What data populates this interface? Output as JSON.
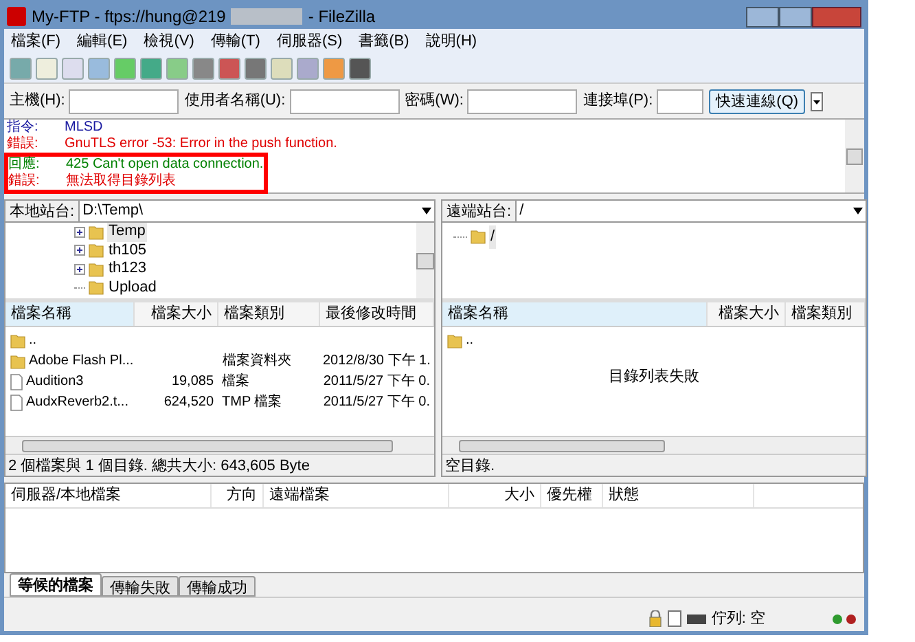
{
  "window": {
    "title_start": "My-FTP - ftps://hung@219",
    "title_end": "- FileZilla"
  },
  "menu": [
    "檔案(F)",
    "編輯(E)",
    "檢視(V)",
    "傳輸(T)",
    "伺服器(S)",
    "書籤(B)",
    "說明(H)"
  ],
  "quickconnect": {
    "fields": [
      {
        "label": "主機(H):"
      },
      {
        "label": "使用者名稱(U):"
      },
      {
        "label": "密碼(W):"
      },
      {
        "label": "連接埠(P):"
      }
    ],
    "button": "快速連線(Q)"
  },
  "log": [
    {
      "kind": "command",
      "prefix": "指令:",
      "text": "MLSD",
      "highlighted": false
    },
    {
      "kind": "error",
      "prefix": "錯誤:",
      "text": "GnuTLS error -53: Error in the push function.",
      "highlighted": false
    },
    {
      "kind": "response",
      "prefix": "回應:",
      "text": "425 Can't open data connection.",
      "highlighted": true
    },
    {
      "kind": "error",
      "prefix": "錯誤:",
      "text": "無法取得目錄列表",
      "highlighted": true
    }
  ],
  "local": {
    "label": "本地站台:",
    "path": "D:\\Temp\\",
    "tree": [
      {
        "name": "Temp",
        "expandable": true,
        "selected": true
      },
      {
        "name": "th105",
        "expandable": true,
        "selected": false
      },
      {
        "name": "th123",
        "expandable": true,
        "selected": false
      },
      {
        "name": "Upload",
        "expandable": false,
        "selected": false
      }
    ],
    "columns": [
      "檔案名稱",
      "檔案大小",
      "檔案類別",
      "最後修改時間"
    ],
    "rows": [
      {
        "kind": "folder",
        "cells": [
          "..",
          "",
          "",
          ""
        ]
      },
      {
        "kind": "folder",
        "cells": [
          "Adobe Flash Pl...",
          "",
          "檔案資料夾",
          "2012/8/30 下午 1."
        ]
      },
      {
        "kind": "file",
        "cells": [
          "Audition3",
          "19,085",
          "檔案",
          "2011/5/27 下午 0."
        ]
      },
      {
        "kind": "file",
        "cells": [
          "AudxReverb2.t...",
          "624,520",
          "TMP 檔案",
          "2011/5/27 下午 0."
        ]
      }
    ],
    "status": "2 個檔案與 1 個目錄. 總共大小: 643,605 Byte"
  },
  "remote": {
    "label": "遠端站台:",
    "path": "/",
    "tree": [
      {
        "name": "/",
        "expandable": false,
        "selected": true
      }
    ],
    "columns": [
      "檔案名稱",
      "檔案大小",
      "檔案類別"
    ],
    "rows": [
      {
        "kind": "folder",
        "cells": [
          "..",
          "",
          ""
        ]
      }
    ],
    "message": "目錄列表失敗",
    "status": "空目錄."
  },
  "queue": {
    "columns": [
      "伺服器/本地檔案",
      "方向",
      "遠端檔案",
      "大小",
      "優先權",
      "狀態"
    ],
    "tabs": [
      {
        "label": "等候的檔案",
        "selected": true
      },
      {
        "label": "傳輸失敗",
        "selected": false
      },
      {
        "label": "傳輸成功",
        "selected": false
      }
    ]
  },
  "status_bar": {
    "queue": "佇列: 空",
    "lights": [
      {
        "color": "#2e9a2e"
      },
      {
        "color": "#b02020"
      }
    ]
  }
}
